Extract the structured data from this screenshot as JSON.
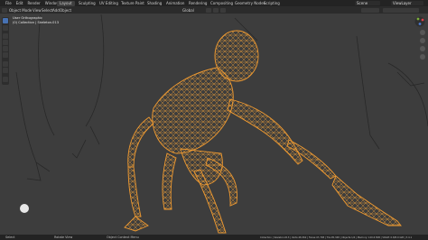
{
  "menu": [
    "File",
    "Edit",
    "Render",
    "Window",
    "Help"
  ],
  "tabs": [
    "Layout",
    "Sculpting",
    "UV Editing",
    "Texture Paint",
    "Shading",
    "Animation",
    "Rendering",
    "Compositing",
    "Geometry Nodes",
    "Scripting"
  ],
  "active_tab": "Layout",
  "scene_name": "Scene",
  "view_layer": "ViewLayer",
  "header": {
    "mode": "Object Mode",
    "view": "View",
    "select": "Select",
    "add": "Add",
    "object": "Object",
    "transform": "Global"
  },
  "overlay": {
    "view_name": "User Orthographic",
    "collection": "(0) Collection | Skeleton.013"
  },
  "statusbar": {
    "left": "Select",
    "middle": "Rotate View",
    "right_left": "Object Context Menu",
    "stats": "Collection | Skeleton.013 | Verts:48,362 | Faces:47,798 | Tris:95,348 | Objects:1/4 | Memory: 120.6 MiB | VRAM: 0.8/8.0 GiB | 3.4.1"
  },
  "icons": [
    "object-mode-icon",
    "select-box-icon",
    "cursor-icon",
    "move-icon",
    "rotate-icon",
    "scale-icon",
    "transform-icon",
    "annotate-icon",
    "measure-icon",
    "add-cube-icon",
    "nav-gizmo-icon",
    "zoom-icon",
    "pan-icon",
    "camera-icon",
    "ortho-icon"
  ]
}
